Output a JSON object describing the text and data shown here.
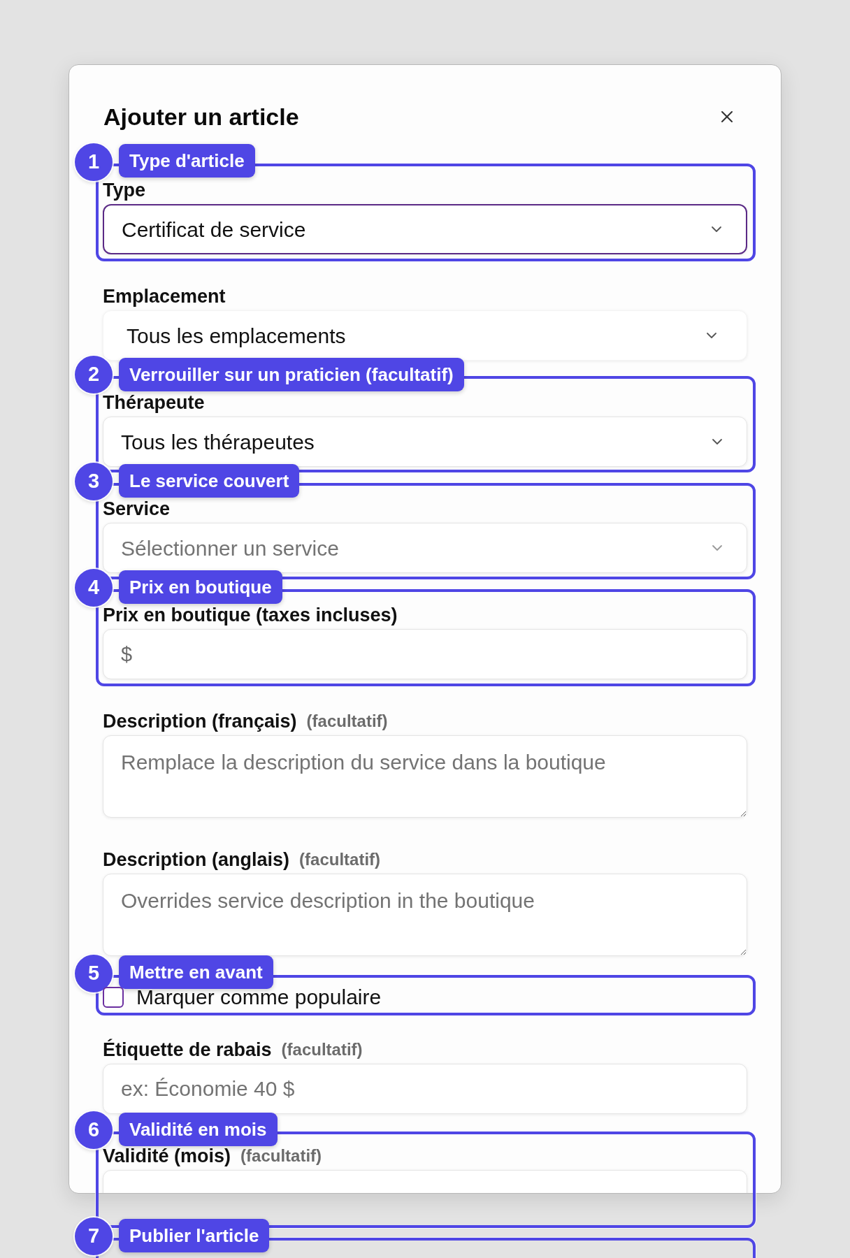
{
  "dialog": {
    "title": "Ajouter un article",
    "fields": [
      {
        "kind": "select",
        "label": "Type",
        "value": "Certificat de service",
        "focused": true
      },
      {
        "kind": "dropdown",
        "label": "Emplacement",
        "value": "Tous les emplacements",
        "focused": false
      },
      {
        "kind": "select",
        "label": "Thérapeute",
        "value": "Tous les thérapeutes",
        "focused": false
      },
      {
        "kind": "select",
        "label": "Service",
        "placeholder": "Sélectionner un service",
        "focused": false
      },
      {
        "kind": "input",
        "label": "Prix en boutique (taxes incluses)",
        "prefix": "$",
        "focused": false
      },
      {
        "kind": "textarea",
        "label": "Description (français)",
        "hint": "(facultatif)",
        "placeholder": "Remplace la description du service dans la boutique",
        "focused": false
      },
      {
        "kind": "textarea",
        "label": "Description (anglais)",
        "hint": "(facultatif)",
        "placeholder": "Overrides service description in the boutique",
        "focused": false
      },
      {
        "kind": "checkbox",
        "label": "Marquer comme populaire",
        "checked": false,
        "focused": false
      },
      {
        "kind": "input",
        "label": "Étiquette de rabais",
        "hint": "(facultatif)",
        "placeholder": "ex: Économie 40 $",
        "focused": false
      },
      {
        "kind": "input",
        "label": "Validité (mois)",
        "hint": "(facultatif)",
        "focused": false
      }
    ]
  },
  "annotations": [
    {
      "number": "1",
      "label": "Type d'article"
    },
    {
      "number": "2",
      "label": "Verrouiller sur un praticien (facultatif)"
    },
    {
      "number": "3",
      "label": "Le service couvert"
    },
    {
      "number": "4",
      "label": "Prix en boutique"
    },
    {
      "number": "5",
      "label": "Mettre en avant"
    },
    {
      "number": "6",
      "label": "Validité en mois"
    },
    {
      "number": "7",
      "label": "Publier l'article"
    }
  ]
}
